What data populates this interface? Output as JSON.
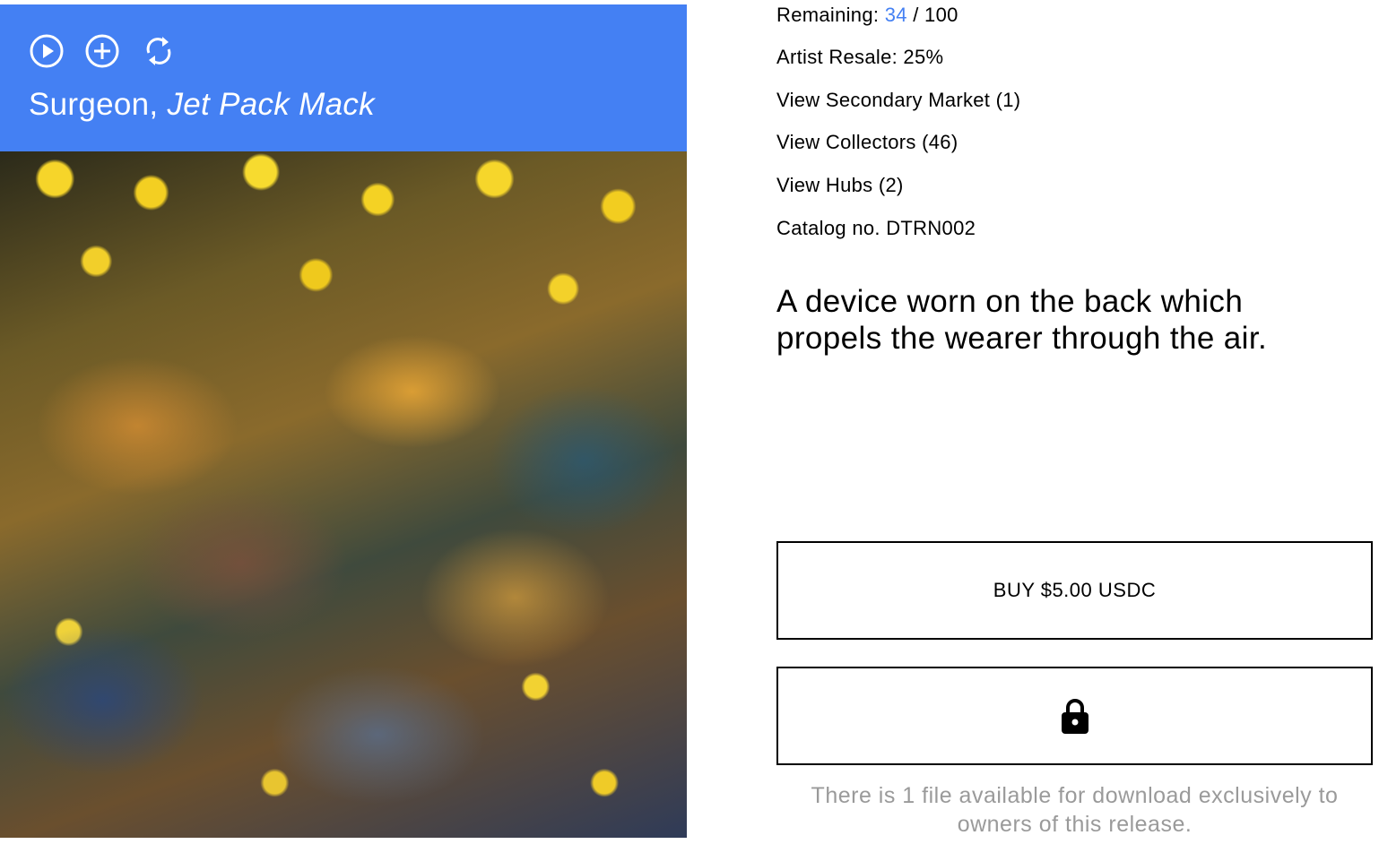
{
  "player": {
    "artist": "Surgeon,",
    "song": "Jet Pack Mack",
    "controls": {
      "play_icon": "play-circle-icon",
      "add_icon": "plus-circle-icon",
      "repeat_icon": "repeat-icon"
    },
    "header_color": "#4480f3"
  },
  "release": {
    "remaining_label": "Remaining:",
    "remaining_count": "34",
    "remaining_total": "/ 100",
    "artist_resale": "Artist Resale: 25%",
    "secondary_market": "View Secondary Market (1)",
    "collectors": "View Collectors (46)",
    "hubs": "View Hubs (2)",
    "catalog": "Catalog no. DTRN002",
    "description": "A device worn on the back which propels the wearer through the air."
  },
  "actions": {
    "buy_label": "BUY $5.00 USDC",
    "locked_icon": "lock-icon",
    "download_note": "There is 1 file available for download exclusively to owners of this release."
  },
  "colors": {
    "accent": "#4480f3",
    "note": "#9a9a9a"
  }
}
